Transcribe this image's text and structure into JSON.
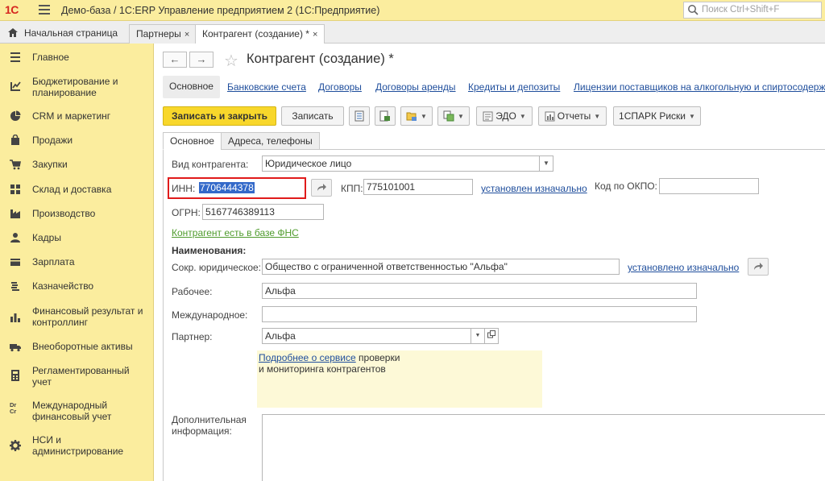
{
  "app": {
    "logo": "1С",
    "title": "Демо-база / 1С:ERP Управление предприятием 2  (1С:Предприятие)",
    "search_placeholder": "Поиск Ctrl+Shift+F"
  },
  "tabs": {
    "home": "Начальная страница",
    "open": [
      {
        "label": "Партнеры",
        "close": "×"
      },
      {
        "label": "Контрагент (создание) *",
        "close": "×"
      }
    ]
  },
  "sidebar": {
    "items": [
      {
        "label": "Главное",
        "icon": "menu-lines-icon"
      },
      {
        "label": "Бюджетирование и планирование",
        "icon": "budget-icon"
      },
      {
        "label": "CRM и маркетинг",
        "icon": "crm-pie-icon"
      },
      {
        "label": "Продажи",
        "icon": "shopping-bag-icon"
      },
      {
        "label": "Закупки",
        "icon": "cart-icon"
      },
      {
        "label": "Склад и доставка",
        "icon": "warehouse-grid-icon"
      },
      {
        "label": "Производство",
        "icon": "factory-icon"
      },
      {
        "label": "Кадры",
        "icon": "person-icon"
      },
      {
        "label": "Зарплата",
        "icon": "wallet-icon"
      },
      {
        "label": "Казначейство",
        "icon": "coins-icon"
      },
      {
        "label": "Финансовый результат и контроллинг",
        "icon": "bar-chart-icon"
      },
      {
        "label": "Внеоборотные активы",
        "icon": "truck-icon"
      },
      {
        "label": "Регламентированный учет",
        "icon": "calculator-icon"
      },
      {
        "label": "Международный финансовый учет",
        "icon": "dr-cr-icon"
      },
      {
        "label": "НСИ и администрирование",
        "icon": "gear-icon"
      }
    ],
    "drcr_glyph": "Dr\nCr"
  },
  "form": {
    "back": "←",
    "forward": "→",
    "star": "☆",
    "title": "Контрагент (создание) *",
    "links": [
      "Основное",
      "Банковские счета",
      "Договоры",
      "Договоры аренды",
      "Кредиты и депозиты",
      "Лицензии поставщиков на алкогольную и спиртосодержа"
    ],
    "toolbar": {
      "save_close": "Записать и закрыть",
      "save": "Записать",
      "edo": "ЭДО",
      "reports": "Отчеты",
      "spark": "1СПАРК Риски"
    },
    "inner_tabs": [
      "Основное",
      "Адреса, телефоны"
    ],
    "fields": {
      "type_label": "Вид контрагента:",
      "type_value": "Юридическое лицо",
      "inn_label": "ИНН:",
      "inn_value": "7706444378",
      "kpp_label": "КПП:",
      "kpp_value": "775101001",
      "kpp_status": "установлен изначально",
      "okpo_label": "Код по ОКПО:",
      "okpo_value": "",
      "ogrn_label": "ОГРН:",
      "ogrn_value": "5167746389113",
      "fns_link": "Контрагент есть в базе ФНС",
      "names_header": "Наименования:",
      "short_label": "Сокр. юридическое:",
      "short_value": "Общество с ограниченной ответственностью \"Альфа\"",
      "short_status": "установлено изначально",
      "work_label": "Рабочее:",
      "work_value": "Альфа",
      "intl_label": "Международное:",
      "intl_value": "",
      "partner_label": "Партнер:",
      "partner_value": "Альфа",
      "info_link": "Подробнее о сервисе",
      "info_text1": " проверки",
      "info_text2": "и мониторинга контрагентов",
      "extra_label": "Дополнительная информация:",
      "extra_value": ""
    }
  },
  "colors": {
    "sidebar_bg": "#fbed9e",
    "primary_button": "#f8d72b",
    "link": "#1f4e9c",
    "fns_link": "#4f9b2d",
    "highlight_frame": "#e01b1b",
    "selection": "#3369c9"
  }
}
